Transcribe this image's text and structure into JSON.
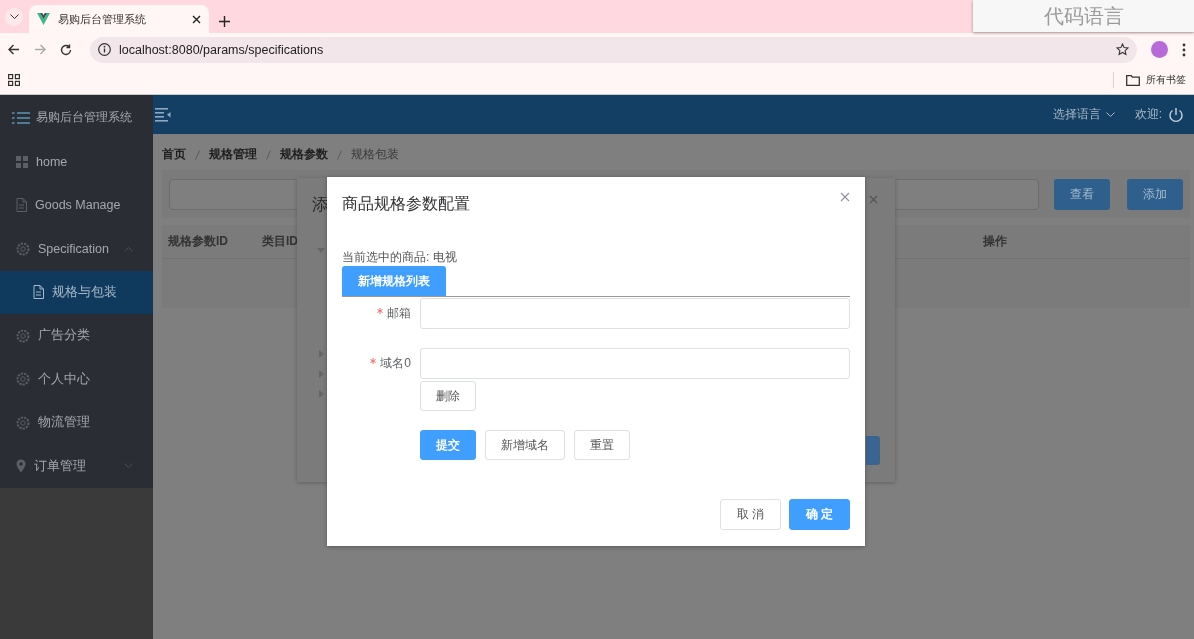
{
  "browser": {
    "tab_title": "易购后台管理系统",
    "url": "localhost:8080/params/specifications",
    "bookmarks_label": "所有书签"
  },
  "overlay_label": "代码语言",
  "sidebar": {
    "title": "易购后台管理系统",
    "items": [
      {
        "label": "home",
        "kind": "grid",
        "selected": false
      },
      {
        "label": "Goods Manage",
        "kind": "page",
        "selected": false
      },
      {
        "label": "Specification",
        "kind": "gear",
        "selected": false,
        "expanded": true,
        "children": [
          {
            "label": "规格与包装",
            "kind": "page",
            "selected": true
          }
        ]
      },
      {
        "label": "广告分类",
        "kind": "gear",
        "selected": false
      },
      {
        "label": "个人中心",
        "kind": "gear",
        "selected": false
      },
      {
        "label": "物流管理",
        "kind": "gear",
        "selected": false
      },
      {
        "label": "订单管理",
        "kind": "pin",
        "selected": false,
        "expanded": false
      }
    ]
  },
  "header": {
    "language_label": "选择语言",
    "welcome": "欢迎:"
  },
  "breadcrumb": [
    {
      "label": "首页",
      "current": false
    },
    {
      "label": "规格管理",
      "current": false
    },
    {
      "label": "规格参数",
      "current": false
    },
    {
      "label": "规格包装",
      "current": true
    }
  ],
  "search": {
    "buttons": [
      "查看",
      "添加"
    ]
  },
  "table": {
    "columns": [
      "规格参数ID",
      "类目ID",
      "操作"
    ]
  },
  "back_dialog": {
    "title": "添"
  },
  "dialog": {
    "title": "商品规格参数配置",
    "selected_product": "当前选中的商品: 电视",
    "add_list_button": "新增规格列表",
    "fields": [
      {
        "label": "邮箱",
        "required": true
      },
      {
        "label": "域名0",
        "required": true,
        "delete_label": "删除"
      }
    ],
    "form_buttons": [
      {
        "label": "提交",
        "kind": "primary"
      },
      {
        "label": "新增域名",
        "kind": "plain"
      },
      {
        "label": "重置",
        "kind": "plain"
      }
    ],
    "footer_buttons": [
      {
        "label": "取 消",
        "kind": "plain"
      },
      {
        "label": "确 定",
        "kind": "primary"
      }
    ]
  }
}
